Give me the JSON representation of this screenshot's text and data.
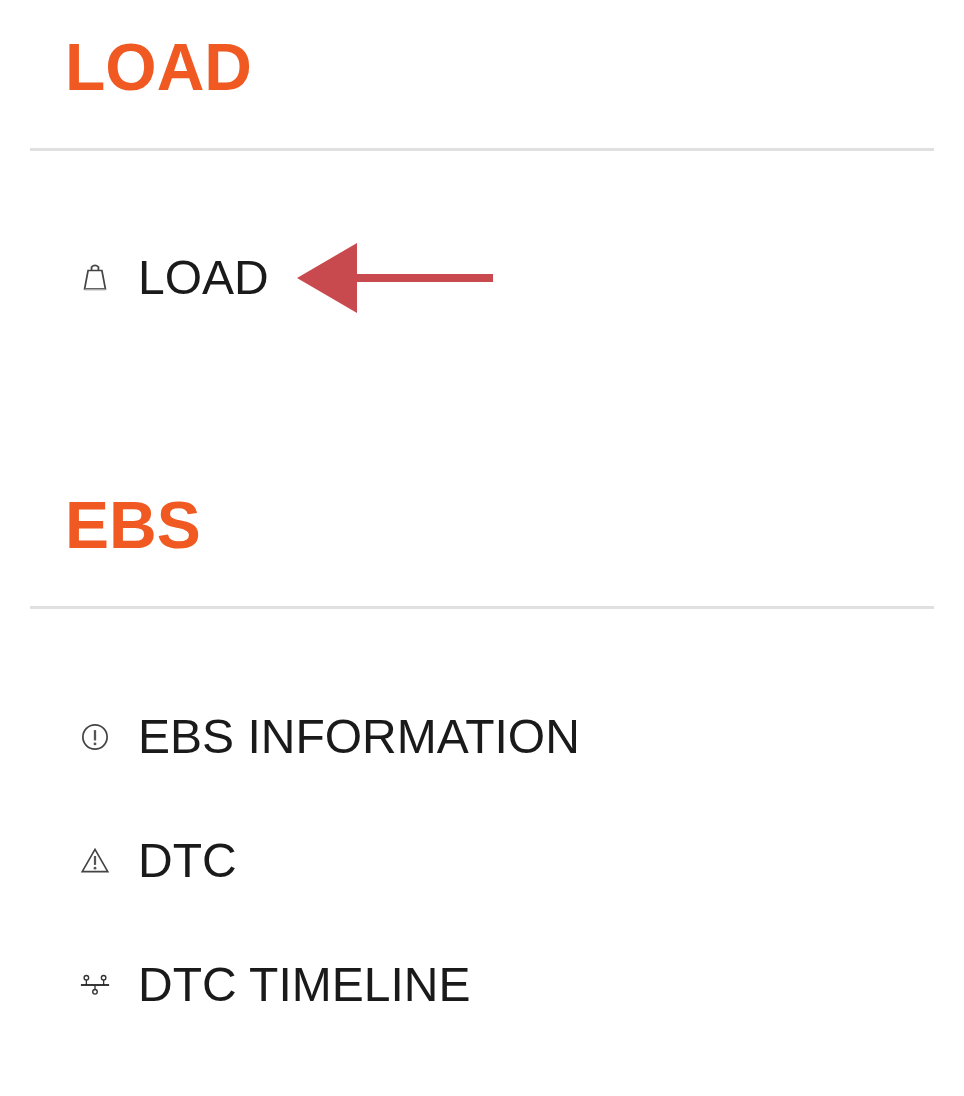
{
  "sections": [
    {
      "title": "LOAD",
      "items": [
        {
          "label": "LOAD",
          "kind": "weight",
          "annotated": true
        }
      ]
    },
    {
      "title": "EBS",
      "items": [
        {
          "label": "EBS INFORMATION",
          "kind": "info",
          "annotated": false
        },
        {
          "label": "DTC",
          "kind": "warning",
          "annotated": false
        },
        {
          "label": "DTC TIMELINE",
          "kind": "timeline",
          "annotated": false
        }
      ]
    }
  ]
}
